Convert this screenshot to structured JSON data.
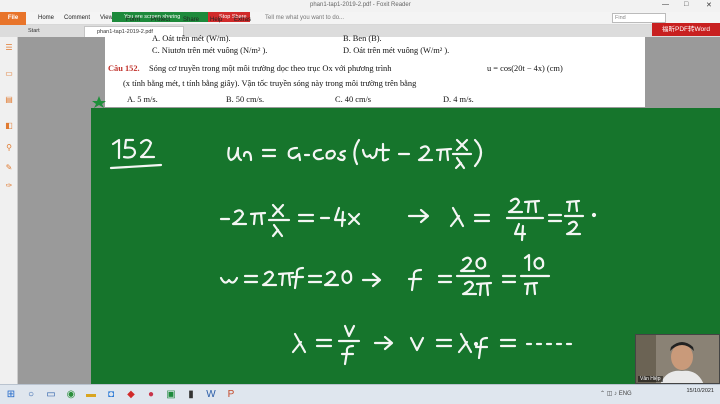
{
  "titlebar": {
    "title": "phan1-tap1-2019-2.pdf - Foxit Reader",
    "minimize": "—",
    "maximize": "□",
    "close": "✕"
  },
  "menu": {
    "file": "File",
    "items": [
      "Home",
      "Comment",
      "View",
      "Form",
      "Protect",
      "Share",
      "Help",
      "Extras"
    ],
    "screen_sharing": "You are screen sharing",
    "stop_share": "Stop Share",
    "tell_me": "Tell me what you want to do...",
    "find_placeholder": "Find",
    "promo": "福昕PDF转Word"
  },
  "tabs": [
    {
      "label": "Start"
    },
    {
      "label": "phan1-tap1-2019-2.pdf"
    }
  ],
  "document": {
    "line1_prefix": "A. Oát trên mét (W/m).",
    "line1_b": "B. Ben (B).",
    "line2_c": "C. Niutơn trên mét vuông (N/m² ).",
    "line2_d": "D. Oát trên mét vuông (W/m² ).",
    "question_number": "Câu 152.",
    "question_text": "Sóng cơ truyền trong một môi trường dọc theo trục Ox với phương trình",
    "equation": "u = cos(20t − 4x)  (cm)",
    "question_text2": "(x tính bằng mét, t tính bằng giây). Vận tốc truyền sóng này trong môi trường trên bằng",
    "answers": [
      "A. 5 m/s.",
      "B. 50 cm/s.",
      "C. 40 cm/s",
      "D. 4 m/s."
    ]
  },
  "webcam": {
    "name": "Văn Hiệp"
  },
  "taskbar": {
    "time": "",
    "date": "15/10/2021"
  }
}
